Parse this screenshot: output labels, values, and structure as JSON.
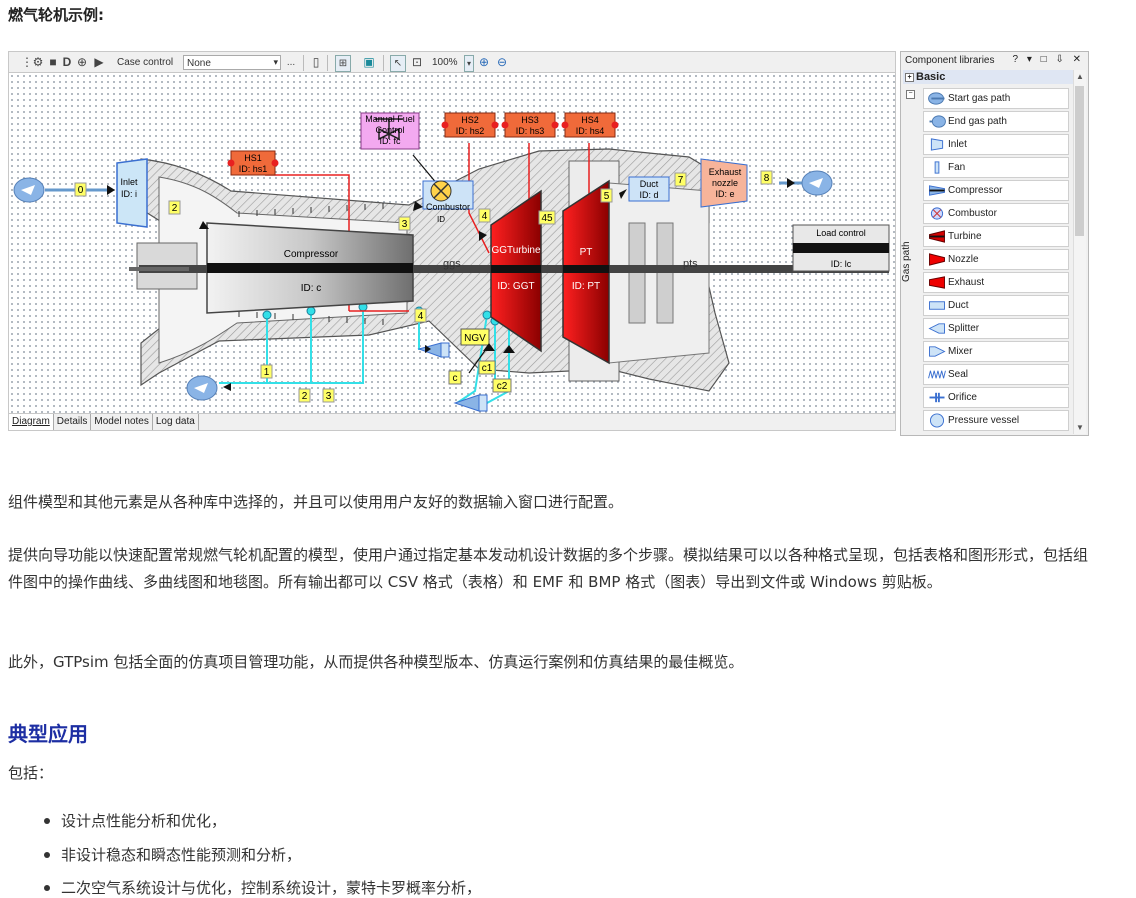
{
  "heading": "燃气轮机示例:",
  "toolbar": {
    "case_label": "Case control",
    "case_value": "None",
    "more": "...",
    "zoom": "100%"
  },
  "tabs": [
    "Diagram",
    "Details",
    "Model notes",
    "Log data"
  ],
  "diagram": {
    "labels": {
      "inlet": "Inlet",
      "inlet_id": "ID: i",
      "compressor": "Compressor",
      "compressor_id": "ID: c",
      "hs1": "HS1",
      "hs1_id": "ID: hs1",
      "hs2": "HS2",
      "hs2_id": "ID: hs2",
      "hs3": "HS3",
      "hs3_id": "ID: hs3",
      "hs4": "HS4",
      "hs4_id": "ID: hs4",
      "fuel1": "Manual Fuel",
      "fuel2": "Control",
      "fuel_id": "ID: fc",
      "combustor": "Combustor",
      "combustor_id": "ID",
      "ggturbine": "GGTurbine",
      "ggt_id": "ID: GGT",
      "pt": "PT",
      "pt_id": "ID: PT",
      "duct": "Duct",
      "duct_id": "ID: d",
      "exhaust1": "Exhaust",
      "exhaust2": "nozzle",
      "exhaust_id": "ID: e",
      "load": "Load control",
      "load_id": "ID: lc",
      "ggs": "ggs",
      "pts": "pts",
      "ngv": "NGV",
      "c": "c",
      "c1": "c1",
      "c2": "c2"
    },
    "stations": [
      "0",
      "2",
      "3",
      "4",
      "45",
      "5",
      "7",
      "8",
      "1",
      "2",
      "3",
      "4"
    ]
  },
  "libraries": {
    "title": "Component libraries",
    "controls": "? ▾ □ ⇩ ✕",
    "group": "Basic",
    "side_label": "Gas path",
    "items": [
      {
        "label": "Start gas path",
        "icon": "start-gas-path-icon"
      },
      {
        "label": "End gas path",
        "icon": "end-gas-path-icon"
      },
      {
        "label": "Inlet",
        "icon": "inlet-icon"
      },
      {
        "label": "Fan",
        "icon": "fan-icon"
      },
      {
        "label": "Compressor",
        "icon": "compressor-icon"
      },
      {
        "label": "Combustor",
        "icon": "combustor-icon"
      },
      {
        "label": "Turbine",
        "icon": "turbine-icon"
      },
      {
        "label": "Nozzle",
        "icon": "nozzle-icon"
      },
      {
        "label": "Exhaust",
        "icon": "exhaust-icon"
      },
      {
        "label": "Duct",
        "icon": "duct-icon"
      },
      {
        "label": "Splitter",
        "icon": "splitter-icon"
      },
      {
        "label": "Mixer",
        "icon": "mixer-icon"
      },
      {
        "label": "Seal",
        "icon": "seal-icon"
      },
      {
        "label": "Orifice",
        "icon": "orifice-icon"
      },
      {
        "label": "Pressure vessel",
        "icon": "pressure-vessel-icon"
      }
    ]
  },
  "paragraphs": [
    "组件模型和其他元素是从各种库中选择的，并且可以使用用户友好的数据输入窗口进行配置。",
    "提供向导功能以快速配置常规燃气轮机配置的模型，使用户通过指定基本发动机设计数据的多个步骤。模拟结果可以以各种格式呈现，包括表格和图形形式，包括组件图中的操作曲线、多曲线图和地毯图。所有输出都可以 CSV 格式（表格）和 EMF 和 BMP 格式（图表）导出到文件或 Windows 剪贴板。",
    "此外，GTPsim 包括全面的仿真项目管理功能，从而提供各种模型版本、仿真运行案例和仿真结果的最佳概览。"
  ],
  "section_heading": "典型应用",
  "includes": "包括：",
  "bullets": [
    "设计点性能分析和优化，",
    "非设计稳态和瞬态性能预测和分析，",
    "二次空气系统设计与优化，控制系统设计，蒙特卡罗概率分析，"
  ],
  "colors": {
    "heading_blue": "#1d2ea3",
    "turbine_red": "#d40000",
    "hs_orange": "#f06a3a",
    "fuel_pink": "#f3a9f0",
    "duct_blue": "#cde3f7",
    "exhaust_salmon": "#f7b49a",
    "station_yellow": "#ffff66",
    "bleed_cyan": "#33e0e8"
  }
}
